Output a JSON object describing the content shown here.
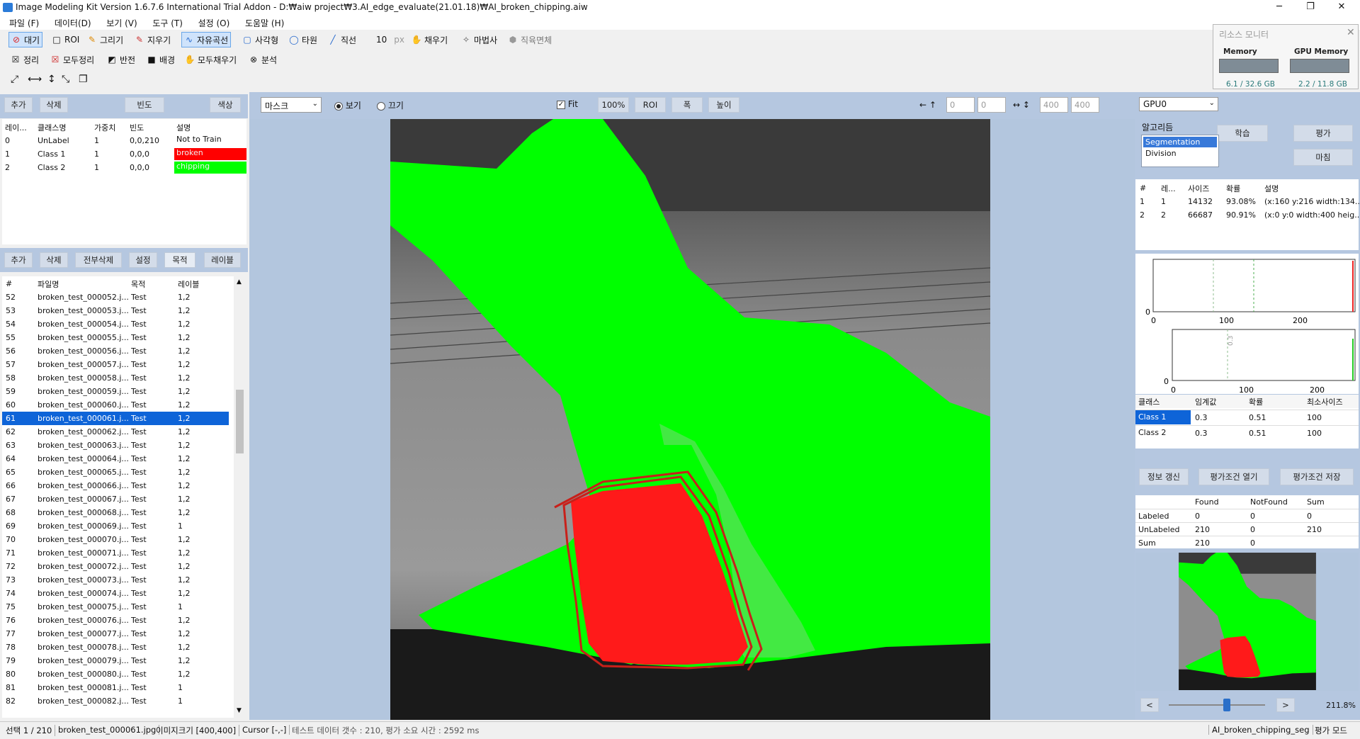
{
  "window": {
    "title": "Image Modeling Kit   Version 1.6.7.6   International Trial Addon   - D:₩aiw project₩3.AI_edge_evaluate(21.01.18)₩AI_broken_chipping.aiw",
    "minimize": "─",
    "maximize": "❐",
    "close": "✕"
  },
  "menu": [
    "파일 (F)",
    "데이터(D)",
    "보기 (V)",
    "도구 (T)",
    "설정 (O)",
    "도움말 (H)"
  ],
  "toolbar1": [
    {
      "label": "대기",
      "icon": "⊘",
      "color": "#d22"
    },
    {
      "label": "ROI",
      "icon": "□",
      "color": "#333"
    },
    {
      "label": "그리기",
      "icon": "✎",
      "color": "#d80"
    },
    {
      "label": "지우기",
      "icon": "✎",
      "color": "#c33"
    },
    {
      "label": "자유곡선",
      "icon": "∿",
      "color": "#26c"
    },
    {
      "label": "사각형",
      "icon": "▢",
      "color": "#26c"
    },
    {
      "label": "타원",
      "icon": "◯",
      "color": "#26c"
    },
    {
      "label": "직선",
      "icon": "╱",
      "color": "#26c"
    },
    {
      "label": "10",
      "icon": "",
      "color": "#333"
    },
    {
      "label": "채우기",
      "icon": "✋",
      "color": "#555"
    },
    {
      "label": "마법사",
      "icon": "✧",
      "color": "#555"
    },
    {
      "label": "직육면체",
      "icon": "⬢",
      "color": "#999"
    }
  ],
  "toolbar1_unit": "px",
  "toolbar2": [
    {
      "label": "정리",
      "icon": "☒",
      "color": "#333"
    },
    {
      "label": "모두정리",
      "icon": "☒",
      "color": "#c22"
    },
    {
      "label": "반전",
      "icon": "◩",
      "color": "#333"
    },
    {
      "label": "배경",
      "icon": "■",
      "color": "#333"
    },
    {
      "label": "모두채우기",
      "icon": "✋",
      "color": "#777"
    },
    {
      "label": "분석",
      "icon": "⊗",
      "color": "#333"
    }
  ],
  "toolbar3_icons": [
    "fit-expand-icon",
    "fit-width-icon",
    "fit-height-icon",
    "fit-all-icon",
    "copy-icon"
  ],
  "resource_monitor": {
    "title": "리소스 모니터",
    "close": "✕",
    "memory_label": "Memory",
    "memory_value": "6.1 / 32.6 GB",
    "gpu_label": "GPU Memory",
    "gpu_value": "2.2 / 11.8 GB"
  },
  "class_panel": {
    "buttons": [
      "추가",
      "삭제",
      "빈도",
      "색상"
    ],
    "headers": [
      "레이...",
      "클래스명",
      "가중치",
      "빈도",
      "설명"
    ],
    "rows": [
      {
        "id": "0",
        "name": "UnLabel",
        "weight": "1",
        "freq": "0,0,210",
        "desc": "Not to Train",
        "color": ""
      },
      {
        "id": "1",
        "name": "Class 1",
        "weight": "1",
        "freq": "0,0,0",
        "desc": "broken",
        "color": "#ff0000"
      },
      {
        "id": "2",
        "name": "Class 2",
        "weight": "1",
        "freq": "0,0,0",
        "desc": "chipping",
        "color": "#00ff00"
      }
    ]
  },
  "file_panel": {
    "buttons": [
      "추가",
      "삭제",
      "전부삭제",
      "설정",
      "목적",
      "레이블"
    ],
    "headers": [
      "#",
      "파일명",
      "목적",
      "레이블"
    ],
    "selected_index": 9,
    "rows": [
      {
        "n": "52",
        "file": "broken_test_000052.j...",
        "purpose": "Test",
        "label": "1,2"
      },
      {
        "n": "53",
        "file": "broken_test_000053.j...",
        "purpose": "Test",
        "label": "1,2"
      },
      {
        "n": "54",
        "file": "broken_test_000054.j...",
        "purpose": "Test",
        "label": "1,2"
      },
      {
        "n": "55",
        "file": "broken_test_000055.j...",
        "purpose": "Test",
        "label": "1,2"
      },
      {
        "n": "56",
        "file": "broken_test_000056.j...",
        "purpose": "Test",
        "label": "1,2"
      },
      {
        "n": "57",
        "file": "broken_test_000057.j...",
        "purpose": "Test",
        "label": "1,2"
      },
      {
        "n": "58",
        "file": "broken_test_000058.j...",
        "purpose": "Test",
        "label": "1,2"
      },
      {
        "n": "59",
        "file": "broken_test_000059.j...",
        "purpose": "Test",
        "label": "1,2"
      },
      {
        "n": "60",
        "file": "broken_test_000060.j...",
        "purpose": "Test",
        "label": "1,2"
      },
      {
        "n": "61",
        "file": "broken_test_000061.j...",
        "purpose": "Test",
        "label": "1,2"
      },
      {
        "n": "62",
        "file": "broken_test_000062.j...",
        "purpose": "Test",
        "label": "1,2"
      },
      {
        "n": "63",
        "file": "broken_test_000063.j...",
        "purpose": "Test",
        "label": "1,2"
      },
      {
        "n": "64",
        "file": "broken_test_000064.j...",
        "purpose": "Test",
        "label": "1,2"
      },
      {
        "n": "65",
        "file": "broken_test_000065.j...",
        "purpose": "Test",
        "label": "1,2"
      },
      {
        "n": "66",
        "file": "broken_test_000066.j...",
        "purpose": "Test",
        "label": "1,2"
      },
      {
        "n": "67",
        "file": "broken_test_000067.j...",
        "purpose": "Test",
        "label": "1,2"
      },
      {
        "n": "68",
        "file": "broken_test_000068.j...",
        "purpose": "Test",
        "label": "1,2"
      },
      {
        "n": "69",
        "file": "broken_test_000069.j...",
        "purpose": "Test",
        "label": "1"
      },
      {
        "n": "70",
        "file": "broken_test_000070.j...",
        "purpose": "Test",
        "label": "1,2"
      },
      {
        "n": "71",
        "file": "broken_test_000071.j...",
        "purpose": "Test",
        "label": "1,2"
      },
      {
        "n": "72",
        "file": "broken_test_000072.j...",
        "purpose": "Test",
        "label": "1,2"
      },
      {
        "n": "73",
        "file": "broken_test_000073.j...",
        "purpose": "Test",
        "label": "1,2"
      },
      {
        "n": "74",
        "file": "broken_test_000074.j...",
        "purpose": "Test",
        "label": "1,2"
      },
      {
        "n": "75",
        "file": "broken_test_000075.j...",
        "purpose": "Test",
        "label": "1"
      },
      {
        "n": "76",
        "file": "broken_test_000076.j...",
        "purpose": "Test",
        "label": "1,2"
      },
      {
        "n": "77",
        "file": "broken_test_000077.j...",
        "purpose": "Test",
        "label": "1,2"
      },
      {
        "n": "78",
        "file": "broken_test_000078.j...",
        "purpose": "Test",
        "label": "1,2"
      },
      {
        "n": "79",
        "file": "broken_test_000079.j...",
        "purpose": "Test",
        "label": "1,2"
      },
      {
        "n": "80",
        "file": "broken_test_000080.j...",
        "purpose": "Test",
        "label": "1,2"
      },
      {
        "n": "81",
        "file": "broken_test_000081.j...",
        "purpose": "Test",
        "label": "1"
      },
      {
        "n": "82",
        "file": "broken_test_000082.j...",
        "purpose": "Test",
        "label": "1"
      }
    ]
  },
  "view_bar": {
    "mode_select": "마스크",
    "radio_view": "보기",
    "radio_off": "끄기",
    "fit_label": "Fit",
    "zoom_100": "100%",
    "roi": "ROI",
    "width": "폭",
    "height": "높이",
    "arrow_left_up": "← ↑",
    "x": "0",
    "y": "0",
    "arrow_lr_ud": "↔ ↕",
    "w": "400",
    "h": "400"
  },
  "right_panel": {
    "gpu_select": "GPU0",
    "algo_label": "알고리듬",
    "algorithms": [
      "Segmentation",
      "Division"
    ],
    "btn_train": "학습",
    "btn_eval": "평가",
    "btn_finish": "마침",
    "result_headers": [
      "#",
      "레...",
      "사이즈",
      "확률",
      "설명"
    ],
    "results": [
      {
        "n": "1",
        "label": "1",
        "size": "14132",
        "prob": "93.08%",
        "desc": "(x:160 y:216 width:134..."
      },
      {
        "n": "2",
        "label": "2",
        "size": "66687",
        "prob": "90.91%",
        "desc": "(x:0 y:0 width:400 heig..."
      }
    ],
    "hist1_ticks": [
      "0",
      "0",
      "100",
      "200"
    ],
    "hist2_ticks": [
      "0",
      "0",
      "100",
      "200"
    ],
    "hist2_marker": "0.3",
    "thr_headers": [
      "클래스",
      "임계값",
      "확률",
      "최소사이즈"
    ],
    "thr_rows": [
      {
        "cls": "Class 1",
        "thr": "0.3",
        "prob": "0.51",
        "min": "100"
      },
      {
        "cls": "Class 2",
        "thr": "0.3",
        "prob": "0.51",
        "min": "100"
      }
    ],
    "btn_refresh": "정보 갱신",
    "btn_open_cond": "평가조건 열기",
    "btn_save_cond": "평가조건 저장",
    "stat_headers": [
      "",
      "Found",
      "NotFound",
      "Sum"
    ],
    "stat_rows": [
      {
        "r": "Labeled",
        "found": "0",
        "notfound": "0",
        "sum": "0"
      },
      {
        "r": "UnLabeled",
        "found": "210",
        "notfound": "0",
        "sum": "210"
      },
      {
        "r": "Sum",
        "found": "210",
        "notfound": "0",
        "sum": ""
      }
    ],
    "prev": "<",
    "next": ">",
    "zoom_pct": "211.8%",
    "slider_fraction": 0.6
  },
  "status": {
    "selection": "선택 1 / 210",
    "file": "broken_test_000061.jpg",
    "image_size": "이미지크기 [400,400]",
    "cursor": "Cursor [-,-]",
    "info": "테스트 데이터 갯수 : 210,   평가 소요 시간 : 2592 ms",
    "model": "AI_broken_chipping_seg",
    "mode": "평가 모드"
  }
}
